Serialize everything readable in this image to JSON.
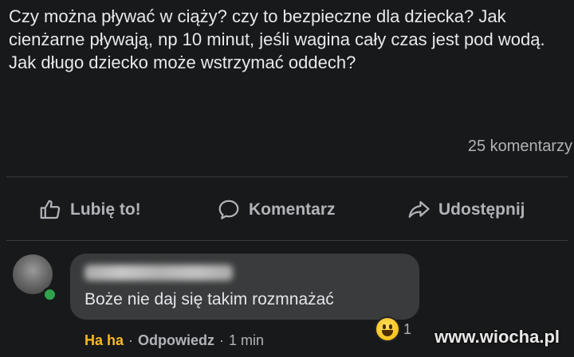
{
  "post": {
    "text": "Czy można pływać w ciąży? czy to bezpieczne dla dziecka? Jak cienżarne pływają, np 10 minut, jeśli wagina cały czas jest pod wodą. Jak długo dziecko może wstrzymać oddech?",
    "comment_count": "25 komentarzy"
  },
  "actions": {
    "like_label": "Lubię to!",
    "comment_label": "Komentarz",
    "share_label": "Udostępnij"
  },
  "comment": {
    "text": "Boże nie daj się takim rozmnażać",
    "reaction_count": "1",
    "reaction_label": "Ha ha",
    "reply_label": "Odpowiedz",
    "time": "1 min",
    "separator": "·"
  },
  "watermark": "www.wiocha.pl",
  "colors": {
    "background": "#18191a",
    "bubble": "#3a3b3c",
    "haha": "#f7b928",
    "online": "#31a24c"
  },
  "icons": {
    "like": "thumbs-up-icon",
    "comment": "speech-bubble-icon",
    "share": "share-arrow-icon",
    "reaction": "laughing-emoji-icon"
  }
}
